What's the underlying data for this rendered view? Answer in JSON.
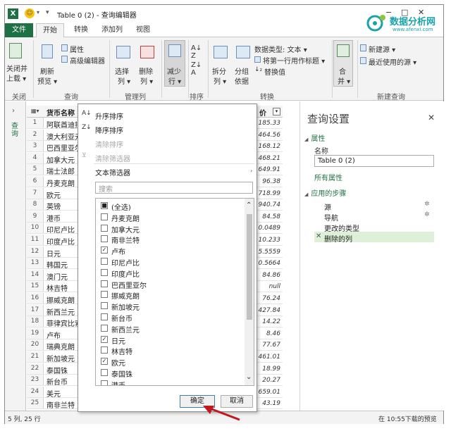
{
  "titlebar": {
    "app_icon": "X",
    "title": "Table 0 (2) - 查询编辑器",
    "minimize": "−",
    "maximize": "□",
    "close": "✕"
  },
  "watermark": {
    "name": "数据分析网",
    "url": "www.afenxi.com",
    "color": "#19a3a9"
  },
  "tabs": [
    {
      "label": "文件"
    },
    {
      "label": "开始"
    },
    {
      "label": "转换"
    },
    {
      "label": "添加列"
    },
    {
      "label": "视图"
    }
  ],
  "ribbon": {
    "close_load": [
      "关闭并",
      "上载 ▾"
    ],
    "refresh": [
      "刷新",
      "预览 ▾"
    ],
    "properties": "属性",
    "advanced_editor": "高级编辑器",
    "choose_cols": [
      "选择",
      "列 ▾"
    ],
    "remove_cols": [
      "删除",
      "列 ▾"
    ],
    "reduce_rows": [
      "减少",
      "行 ▾"
    ],
    "split": [
      "拆分",
      "列 ▾"
    ],
    "group_by": [
      "分组",
      "依据"
    ],
    "data_type": "数据类型: 文本 ▾",
    "first_row_header": "将第一行用作标题 ▾",
    "replace_values": "替换值",
    "merge": [
      "合",
      "并 ▾"
    ],
    "new_source": "新建源 ▾",
    "recent_sources": "最近使用的源 ▾",
    "groups": {
      "close": "关闭",
      "query": "查询",
      "manage_cols": "管理列",
      "sort": "排序",
      "transform": "转换",
      "new_query": "新建查询"
    }
  },
  "leftnav": {
    "chevron": "›",
    "label": "查询"
  },
  "grid": {
    "col_name": "货币名称",
    "col_price": "价",
    "rows": [
      {
        "n": "1",
        "name": "阿联酋迪拉",
        "val": "185.33"
      },
      {
        "n": "2",
        "name": "澳大利亚元",
        "val": "464.56"
      },
      {
        "n": "3",
        "name": "巴西里亚尔",
        "val": "168.12"
      },
      {
        "n": "4",
        "name": "加拿大元",
        "val": "468.21"
      },
      {
        "n": "5",
        "name": "瑞士法郎",
        "val": "649.91"
      },
      {
        "n": "6",
        "name": "丹麦克朗",
        "val": "96.38"
      },
      {
        "n": "7",
        "name": "欧元",
        "val": "718.99"
      },
      {
        "n": "8",
        "name": "英镑",
        "val": "940.74"
      },
      {
        "n": "9",
        "name": "港币",
        "val": "84.58"
      },
      {
        "n": "10",
        "name": "印尼卢比",
        "val": "0.0489"
      },
      {
        "n": "11",
        "name": "印度卢比",
        "val": "10.233"
      },
      {
        "n": "12",
        "name": "日元",
        "val": "5.5559"
      },
      {
        "n": "13",
        "name": "韩国元",
        "val": "0.5664"
      },
      {
        "n": "14",
        "name": "澳门元",
        "val": "84.86"
      },
      {
        "n": "15",
        "name": "林吉特",
        "val": "null"
      },
      {
        "n": "16",
        "name": "挪威克朗",
        "val": "76.24"
      },
      {
        "n": "17",
        "name": "新西兰元",
        "val": "427.84"
      },
      {
        "n": "18",
        "name": "菲律宾比索",
        "val": "14.22"
      },
      {
        "n": "19",
        "name": "卢布",
        "val": "8.46"
      },
      {
        "n": "20",
        "name": "瑞典克朗",
        "val": "77.67"
      },
      {
        "n": "21",
        "name": "新加坡元",
        "val": "461.01"
      },
      {
        "n": "22",
        "name": "泰国铢",
        "val": "18.99"
      },
      {
        "n": "23",
        "name": "新台币",
        "val": "20.27"
      },
      {
        "n": "24",
        "name": "美元",
        "val": "659.01"
      },
      {
        "n": "25",
        "name": "南非兰特",
        "val": "43.19"
      }
    ]
  },
  "filter": {
    "sort_asc": "升序排序",
    "sort_desc": "降序排序",
    "clear_sort": "清除排序",
    "clear_filter": "清除筛选器",
    "text_filters": "文本筛选器",
    "search_placeholder": "搜索",
    "items": [
      {
        "label": "(全选)",
        "state": "partial"
      },
      {
        "label": "丹麦克朗",
        "state": "unchecked"
      },
      {
        "label": "加拿大元",
        "state": "unchecked"
      },
      {
        "label": "南非兰特",
        "state": "unchecked"
      },
      {
        "label": "卢布",
        "state": "checked"
      },
      {
        "label": "印尼卢比",
        "state": "unchecked"
      },
      {
        "label": "印度卢比",
        "state": "unchecked"
      },
      {
        "label": "巴西里亚尔",
        "state": "unchecked"
      },
      {
        "label": "挪威克朗",
        "state": "unchecked"
      },
      {
        "label": "新加坡元",
        "state": "unchecked"
      },
      {
        "label": "新台币",
        "state": "unchecked"
      },
      {
        "label": "新西兰元",
        "state": "unchecked"
      },
      {
        "label": "日元",
        "state": "checked"
      },
      {
        "label": "林吉特",
        "state": "unchecked"
      },
      {
        "label": "欧元",
        "state": "checked"
      },
      {
        "label": "泰国铢",
        "state": "unchecked"
      },
      {
        "label": "港币",
        "state": "unchecked"
      }
    ],
    "ok": "确定",
    "cancel": "取消"
  },
  "rpane": {
    "title": "查询设置",
    "close": "✕",
    "properties": "属性",
    "name_label": "名称",
    "name_value": "Table 0 (2)",
    "all_props": "所有属性",
    "applied_steps": "应用的步骤",
    "steps": [
      {
        "label": "源",
        "gear": true
      },
      {
        "label": "导航",
        "gear": true
      },
      {
        "label": "更改的类型",
        "gear": false
      },
      {
        "label": "删除的列",
        "gear": false,
        "selected": true
      }
    ]
  },
  "status": {
    "left": "5 列, 25 行",
    "right": "在 10:55下载的预览"
  }
}
